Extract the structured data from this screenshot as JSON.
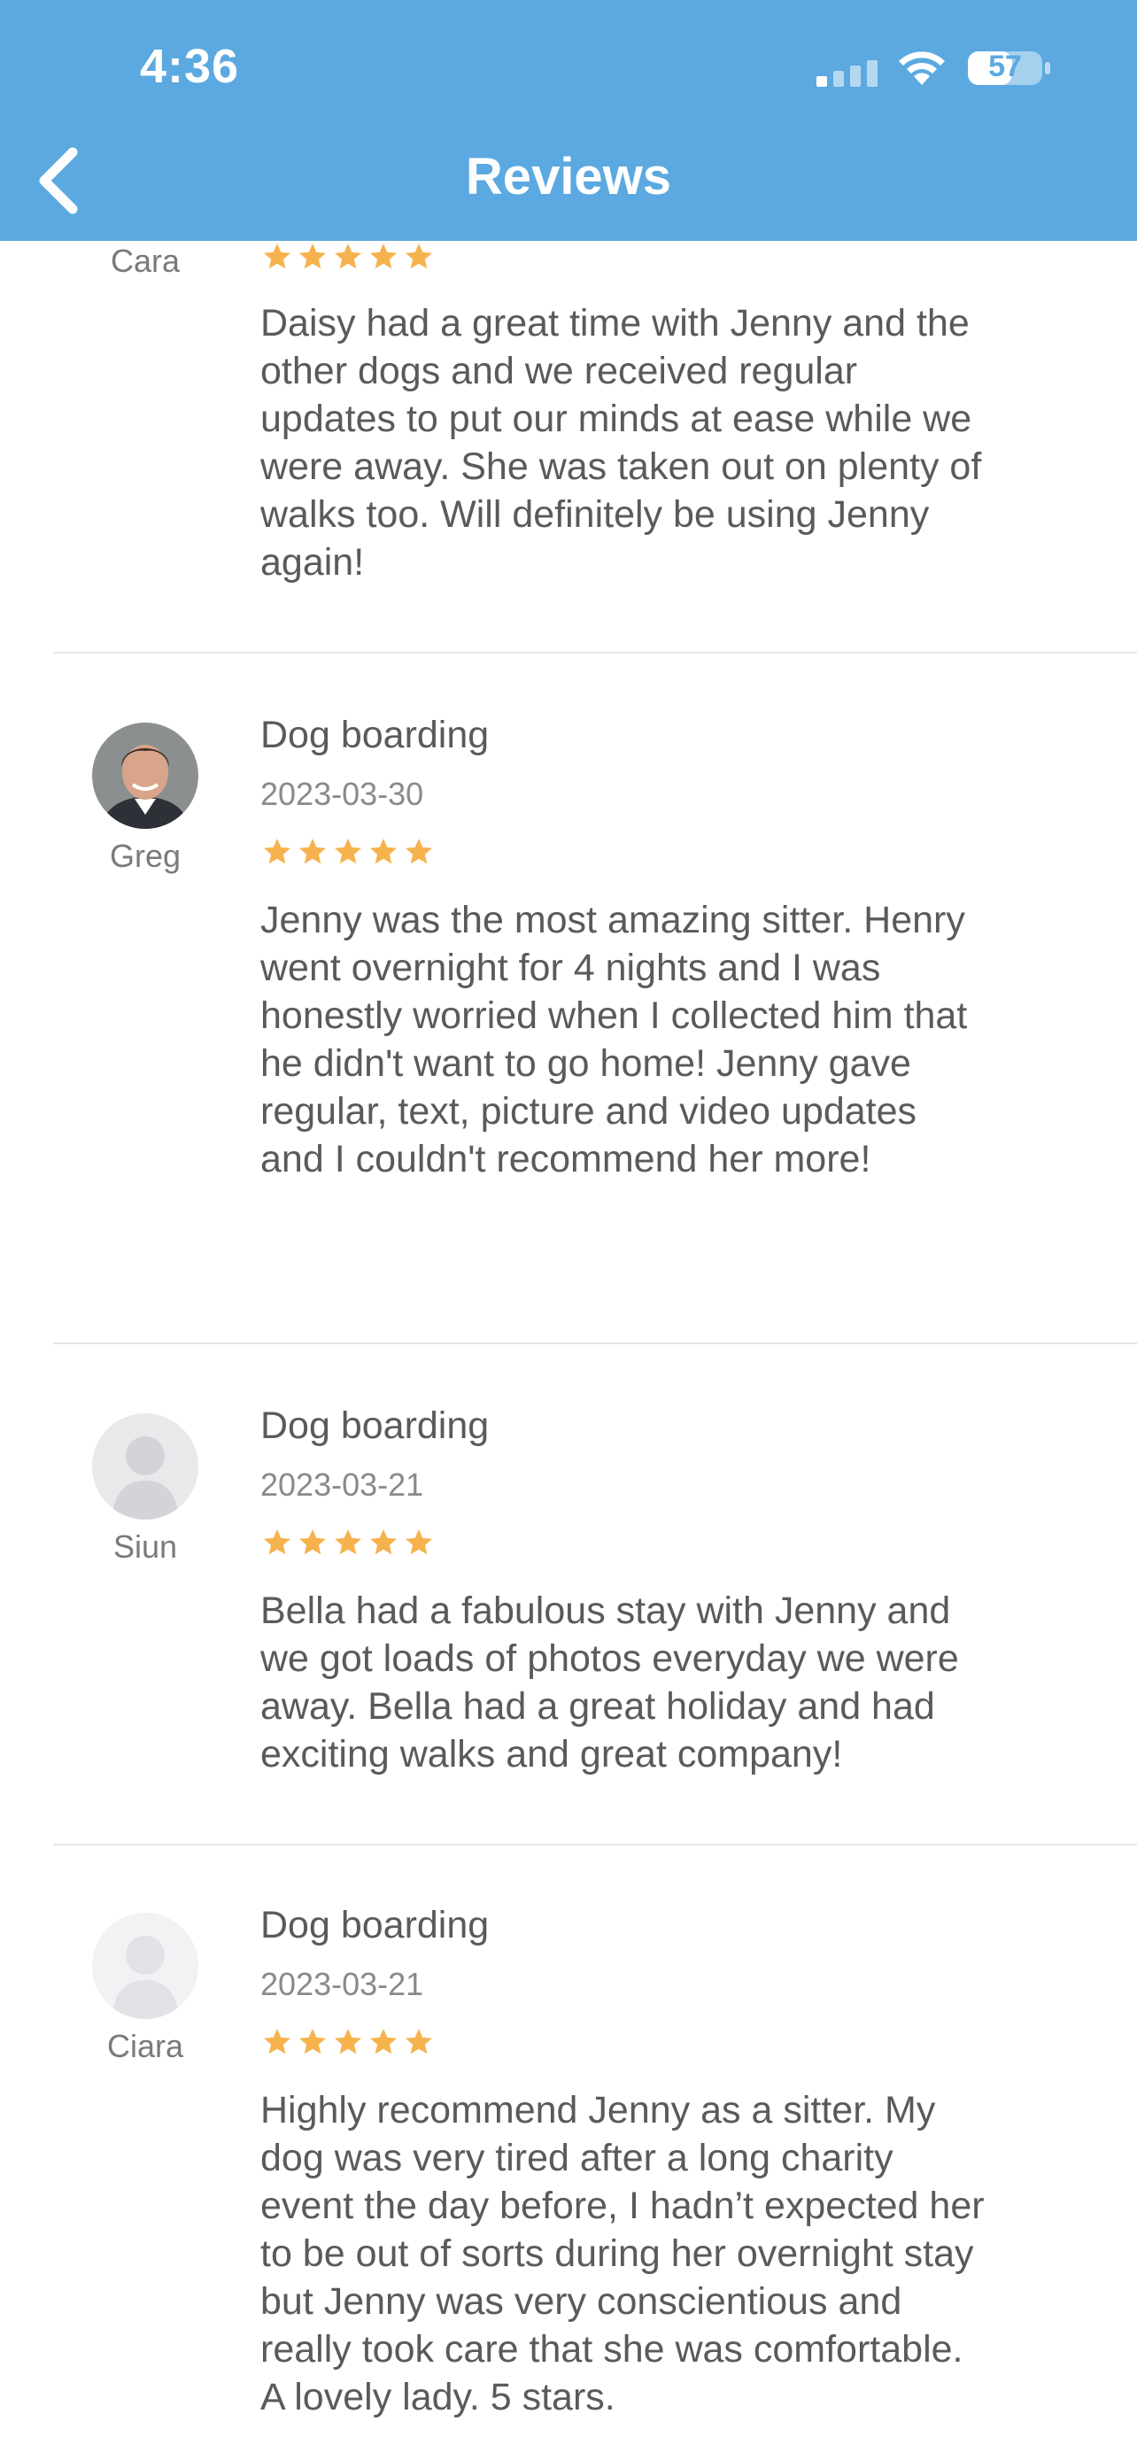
{
  "status_bar": {
    "time": "4:36",
    "battery_level": "57"
  },
  "header": {
    "title": "Reviews",
    "back_icon": "chevron-left-icon"
  },
  "colors": {
    "header_bg": "#5ba9e0",
    "star": "#f6b24d",
    "divider": "#e6e6e6"
  },
  "reviews": [
    {
      "name": "Cara",
      "rating": 5,
      "text": "Daisy had a great time with Jenny and the\nother dogs and we received regular\nupdates to put our minds at ease while we\nwere away. She was taken out on plenty of\nwalks too. Will definitely be using Jenny\nagain!"
    },
    {
      "name": "Greg",
      "service": "Dog boarding",
      "date": "2023-03-30",
      "rating": 5,
      "text": "Jenny was the most amazing sitter. Henry\nwent overnight for 4 nights and I was\nhonestly worried when I collected him that\nhe didn't want to go home! Jenny gave\nregular, text, picture and video updates\nand I couldn't recommend her more!"
    },
    {
      "name": "Siun",
      "service": "Dog boarding",
      "date": "2023-03-21",
      "rating": 5,
      "text": "Bella had a fabulous stay with Jenny and\nwe got loads of photos everyday we were\naway. Bella had a great holiday and had\nexciting walks and great company!"
    },
    {
      "name": "Ciara",
      "service": "Dog boarding",
      "date": "2023-03-21",
      "rating": 5,
      "text": "Highly recommend Jenny as a sitter. My\ndog was very tired after a long charity\nevent the day before, I hadn’t expected her\nto be out of sorts during her overnight stay\nbut Jenny was very conscientious and\nreally took care that she was comfortable.\nA lovely lady. 5 stars."
    }
  ]
}
